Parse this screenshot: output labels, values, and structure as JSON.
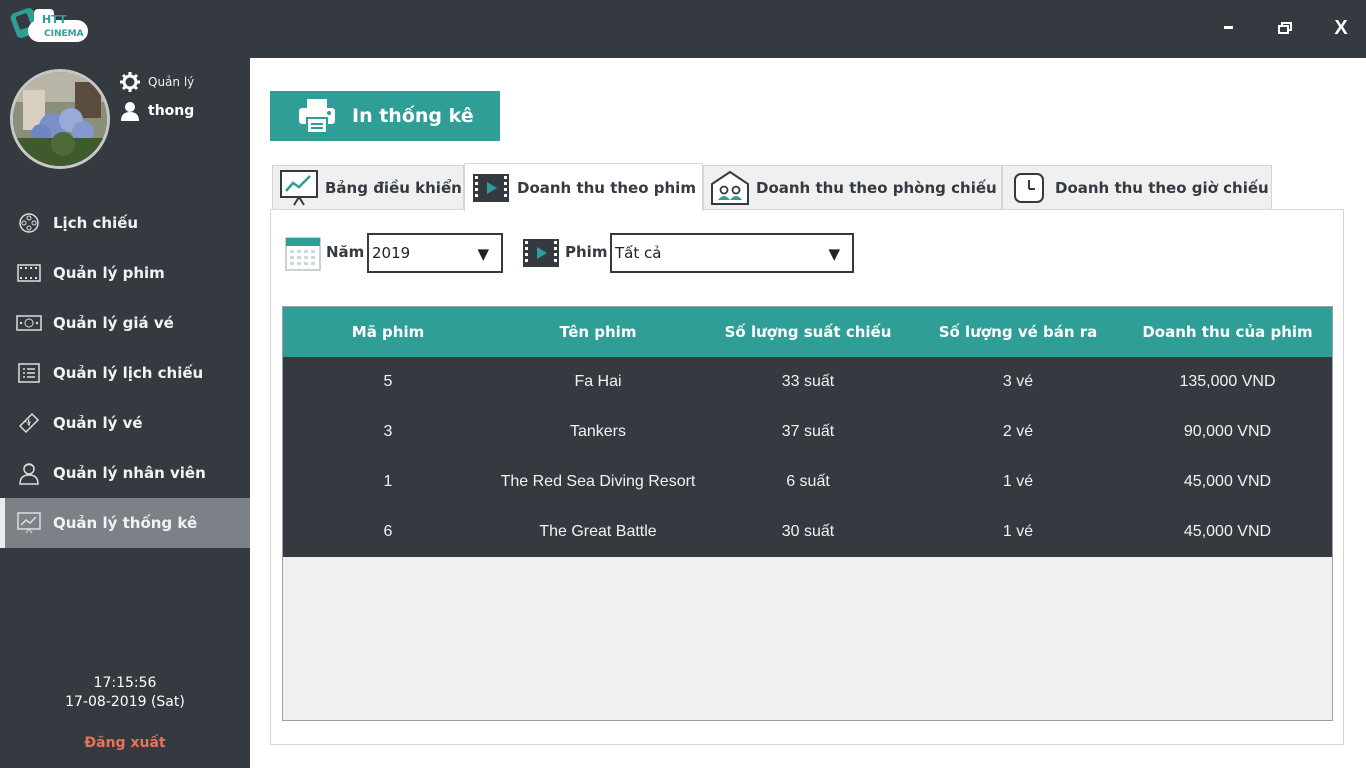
{
  "app": {
    "logo_text_top": "HTT",
    "logo_text_bottom": "CINEMA"
  },
  "window": {
    "minimize": "-",
    "maximize": "❐",
    "close": "X"
  },
  "user": {
    "role": "Quản lý",
    "name": "thong"
  },
  "sidebar": {
    "items": [
      {
        "label": "Lịch chiếu",
        "icon": "film-reel-icon"
      },
      {
        "label": "Quản lý phim",
        "icon": "film-strip-icon"
      },
      {
        "label": "Quản lý giá vé",
        "icon": "money-icon"
      },
      {
        "label": "Quản lý lịch chiếu",
        "icon": "list-icon"
      },
      {
        "label": "Quản lý vé",
        "icon": "ticket-icon"
      },
      {
        "label": "Quản lý nhân viên",
        "icon": "employee-icon"
      },
      {
        "label": "Quản lý thống kê",
        "icon": "stats-board-icon"
      }
    ],
    "active_index": 6,
    "time": "17:15:56",
    "date": "17-08-2019 (Sat)",
    "logout": "Đăng xuất"
  },
  "toolbar": {
    "print_label": "In thống kê"
  },
  "tabs": [
    {
      "label": "Bảng điều khiển",
      "icon": "dashboard-chart-icon"
    },
    {
      "label": "Doanh thu theo phim",
      "icon": "video-icon"
    },
    {
      "label": "Doanh thu theo phòng chiếu",
      "icon": "theater-room-icon"
    },
    {
      "label": "Doanh thu theo giờ chiếu",
      "icon": "clock-icon"
    }
  ],
  "active_tab": 1,
  "filters": {
    "year_label": "Năm",
    "year_value": "2019",
    "movie_label": "Phim",
    "movie_value": "Tất cả"
  },
  "table": {
    "columns": [
      "Mã phim",
      "Tên phim",
      "Số lượng suất chiếu",
      "Số lượng vé bán ra",
      "Doanh thu của phim"
    ],
    "rows": [
      [
        "5",
        "Fa Hai",
        "33 suất",
        "3 vé",
        "135,000 VND"
      ],
      [
        "3",
        "Tankers",
        "37 suất",
        "2 vé",
        "90,000 VND"
      ],
      [
        "1",
        "The Red Sea Diving Resort",
        "6 suất",
        "1 vé",
        "45,000 VND"
      ],
      [
        "6",
        "The Great Battle",
        "30 suất",
        "1 vé",
        "45,000 VND"
      ]
    ]
  },
  "colors": {
    "dark": "#343a40",
    "accent": "#2e9e96",
    "active_menu": "#7c8188",
    "logout": "#e8735a"
  }
}
